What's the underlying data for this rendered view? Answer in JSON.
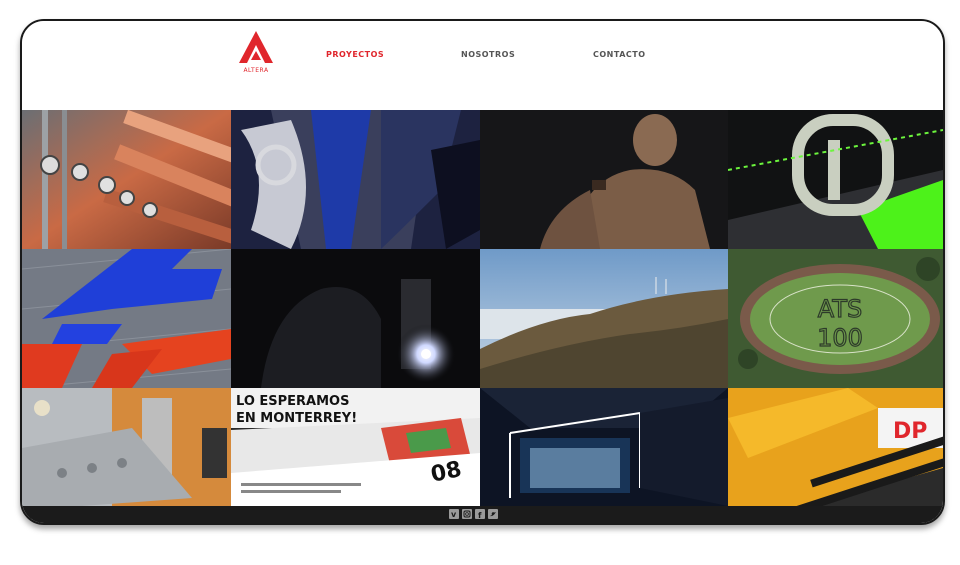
{
  "header": {
    "logo_text": "ALTERA",
    "nav": [
      {
        "label": "PROYECTOS",
        "active": true
      },
      {
        "label": "NOSOTROS",
        "active": false
      },
      {
        "label": "CONTACTO",
        "active": false
      }
    ]
  },
  "colors": {
    "accent": "#e0262c",
    "footer_bg": "#1b1b1b",
    "nav_inactive": "#555555"
  },
  "projects": [
    {
      "icon": "industrial-pipes-image"
    },
    {
      "icon": "ornamental-crest-image"
    },
    {
      "icon": "athlete-portrait-image"
    },
    {
      "icon": "harness-buckle-image"
    },
    {
      "icon": "red-blue-logo-3d-image"
    },
    {
      "icon": "welding-sparks-image"
    },
    {
      "icon": "mountain-landscape-image"
    },
    {
      "icon": "stadium-aerial-image"
    },
    {
      "icon": "construction-equipment-image"
    },
    {
      "icon": "print-materials-image",
      "text_line1": "LO ESPERAMOS",
      "text_line2": "EN MONTERREY!",
      "number": "08"
    },
    {
      "icon": "warehouse-interior-image"
    },
    {
      "icon": "yellow-machinery-image",
      "brand_text": "DP"
    }
  ],
  "stadium_text": {
    "line1": "ATS",
    "line2": "100"
  },
  "footer": {
    "social": [
      "vimeo-icon",
      "instagram-icon",
      "facebook-icon",
      "twitter-icon"
    ]
  }
}
